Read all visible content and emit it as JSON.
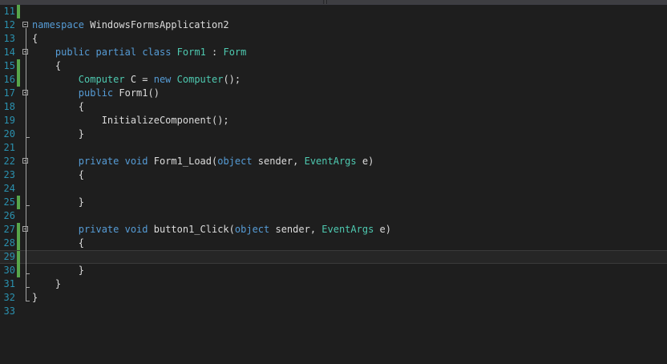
{
  "colors": {
    "background": "#1e1e1e",
    "line_number": "#2b91af",
    "keyword": "#569cd6",
    "type": "#4ec9b0",
    "plain": "#dcdcdc",
    "change_bar": "#57a64a"
  },
  "editor": {
    "lines": [
      {
        "n": "11",
        "changed": true,
        "tokens": []
      },
      {
        "n": "12",
        "fold": true,
        "tokens": [
          {
            "t": "namespace",
            "k": "kw"
          },
          {
            "t": " WindowsFormsApplication2",
            "k": "pl"
          }
        ]
      },
      {
        "n": "13",
        "tokens": [
          {
            "t": "{",
            "k": "pl"
          }
        ]
      },
      {
        "n": "14",
        "fold": true,
        "tokens": [
          {
            "t": "    ",
            "k": "pl"
          },
          {
            "t": "public",
            "k": "kw"
          },
          {
            "t": " ",
            "k": "pl"
          },
          {
            "t": "partial",
            "k": "kw"
          },
          {
            "t": " ",
            "k": "pl"
          },
          {
            "t": "class",
            "k": "kw"
          },
          {
            "t": " ",
            "k": "pl"
          },
          {
            "t": "Form1",
            "k": "ty"
          },
          {
            "t": " : ",
            "k": "pl"
          },
          {
            "t": "Form",
            "k": "ty"
          }
        ]
      },
      {
        "n": "15",
        "changed": true,
        "tokens": [
          {
            "t": "    {",
            "k": "pl"
          }
        ]
      },
      {
        "n": "16",
        "changed": true,
        "tokens": [
          {
            "t": "        ",
            "k": "pl"
          },
          {
            "t": "Computer",
            "k": "ty"
          },
          {
            "t": " C = ",
            "k": "pl"
          },
          {
            "t": "new",
            "k": "kw"
          },
          {
            "t": " ",
            "k": "pl"
          },
          {
            "t": "Computer",
            "k": "ty"
          },
          {
            "t": "();",
            "k": "pl"
          }
        ]
      },
      {
        "n": "17",
        "fold": true,
        "tokens": [
          {
            "t": "        ",
            "k": "pl"
          },
          {
            "t": "public",
            "k": "kw"
          },
          {
            "t": " Form1()",
            "k": "pl"
          }
        ]
      },
      {
        "n": "18",
        "tokens": [
          {
            "t": "        {",
            "k": "pl"
          }
        ]
      },
      {
        "n": "19",
        "tokens": [
          {
            "t": "            InitializeComponent();",
            "k": "pl"
          }
        ]
      },
      {
        "n": "20",
        "tokens": [
          {
            "t": "        }",
            "k": "pl"
          }
        ]
      },
      {
        "n": "21",
        "tokens": []
      },
      {
        "n": "22",
        "fold": true,
        "tokens": [
          {
            "t": "        ",
            "k": "pl"
          },
          {
            "t": "private",
            "k": "kw"
          },
          {
            "t": " ",
            "k": "pl"
          },
          {
            "t": "void",
            "k": "kw"
          },
          {
            "t": " Form1_Load(",
            "k": "pl"
          },
          {
            "t": "object",
            "k": "kw"
          },
          {
            "t": " sender, ",
            "k": "pl"
          },
          {
            "t": "EventArgs",
            "k": "ty"
          },
          {
            "t": " e)",
            "k": "pl"
          }
        ]
      },
      {
        "n": "23",
        "tokens": [
          {
            "t": "        {",
            "k": "pl"
          }
        ]
      },
      {
        "n": "24",
        "tokens": []
      },
      {
        "n": "25",
        "changed": true,
        "tokens": [
          {
            "t": "        }",
            "k": "pl"
          }
        ]
      },
      {
        "n": "26",
        "tokens": []
      },
      {
        "n": "27",
        "fold": true,
        "changed": true,
        "tokens": [
          {
            "t": "        ",
            "k": "pl"
          },
          {
            "t": "private",
            "k": "kw"
          },
          {
            "t": " ",
            "k": "pl"
          },
          {
            "t": "void",
            "k": "kw"
          },
          {
            "t": " button1_Click(",
            "k": "pl"
          },
          {
            "t": "object",
            "k": "kw"
          },
          {
            "t": " sender, ",
            "k": "pl"
          },
          {
            "t": "EventArgs",
            "k": "ty"
          },
          {
            "t": " e)",
            "k": "pl"
          }
        ]
      },
      {
        "n": "28",
        "changed": true,
        "tokens": [
          {
            "t": "        {",
            "k": "pl"
          }
        ]
      },
      {
        "n": "29",
        "changed": true,
        "current": true,
        "tokens": []
      },
      {
        "n": "30",
        "changed": true,
        "tokens": [
          {
            "t": "        }",
            "k": "pl"
          }
        ]
      },
      {
        "n": "31",
        "tokens": [
          {
            "t": "    }",
            "k": "pl"
          }
        ]
      },
      {
        "n": "32",
        "tokens": [
          {
            "t": "}",
            "k": "pl"
          }
        ]
      },
      {
        "n": "33",
        "tokens": []
      }
    ]
  }
}
